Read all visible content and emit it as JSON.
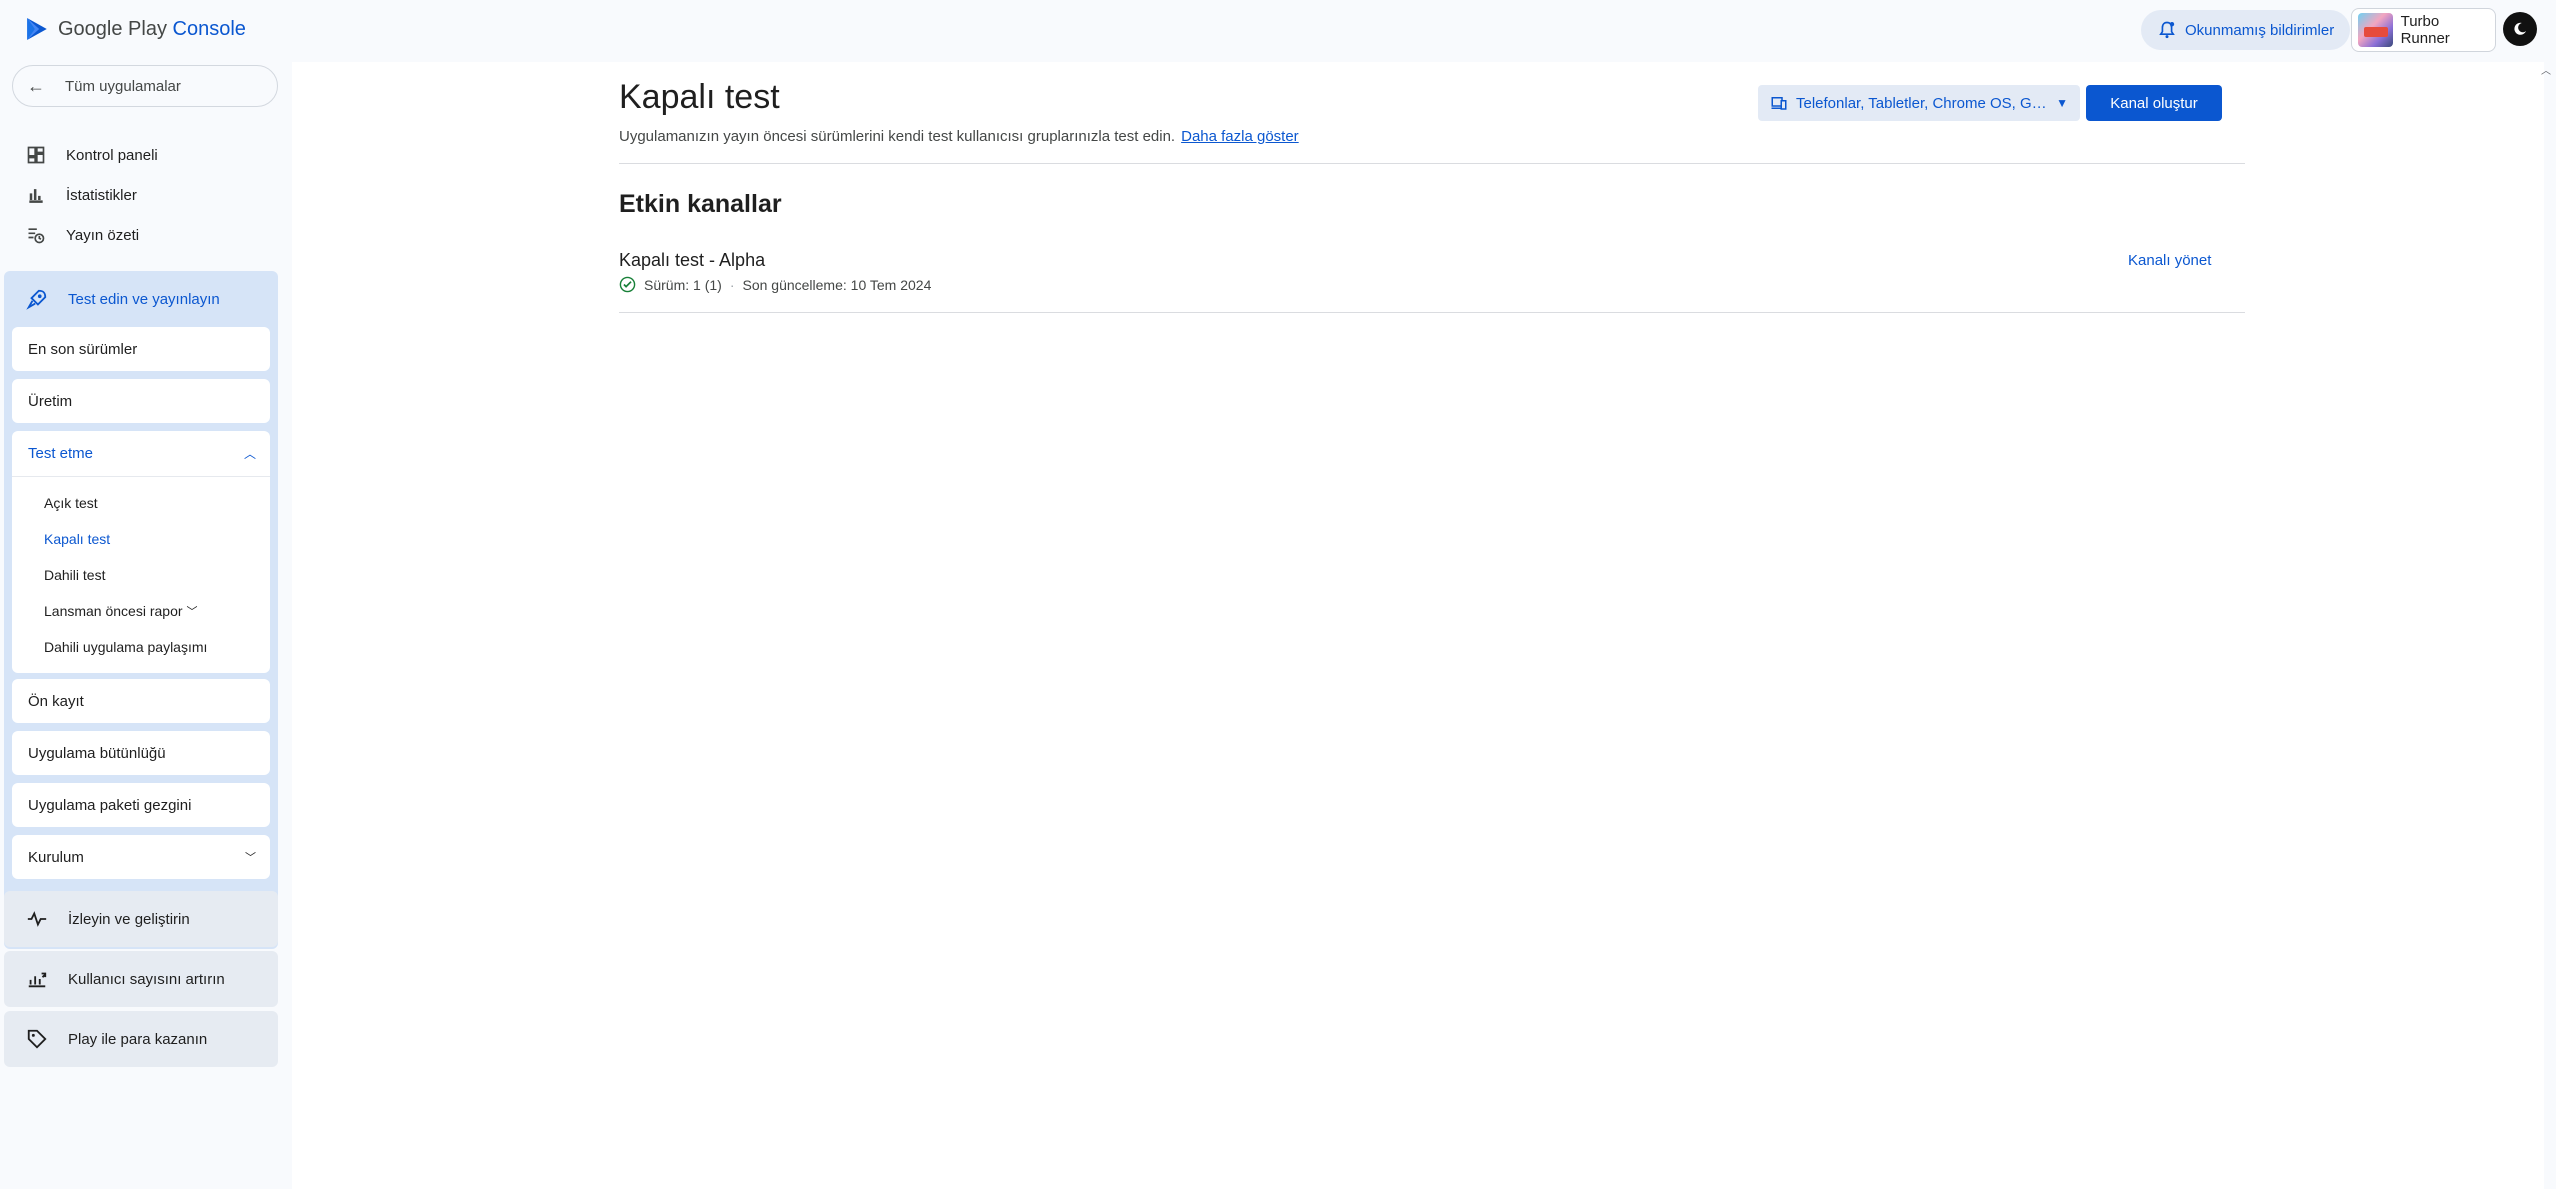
{
  "header": {
    "logo_text_a": "Google Play",
    "logo_text_b": "Console",
    "notifications_label": "Okunmamış bildirimler",
    "app_name": "Turbo Runner"
  },
  "sidebar": {
    "back_label": "Tüm uygulamalar",
    "top_items": [
      {
        "label": "Kontrol paneli",
        "icon": "dashboard-icon"
      },
      {
        "label": "İstatistikler",
        "icon": "bar-chart-icon"
      },
      {
        "label": "Yayın özeti",
        "icon": "publishing-overview-icon"
      }
    ],
    "release_group": {
      "label": "Test edin ve yayınlayın",
      "items": [
        "En son sürümler",
        "Üretim"
      ],
      "testing": {
        "label": "Test etme",
        "children": [
          "Açık test",
          "Kapalı test",
          "Dahili test",
          "Lansman öncesi rapor",
          "Dahili uygulama paylaşımı"
        ]
      },
      "items_after": [
        "Ön kayıt",
        "Uygulama bütünlüğü",
        "Uygulama paketi gezgini",
        "Kurulum"
      ]
    },
    "other_groups": [
      {
        "label": "İzleyin ve geliştirin",
        "icon": "monitor-icon"
      },
      {
        "label": "Kullanıcı sayısını artırın",
        "icon": "grow-icon"
      },
      {
        "label": "Play ile para kazanın",
        "icon": "monetize-tag-icon"
      }
    ]
  },
  "main": {
    "title": "Kapalı test",
    "description": "Uygulamanızın yayın öncesi sürümlerini kendi test kullanıcısı gruplarınızla test edin.",
    "learn_more": "Daha fazla göster",
    "device_filter": "Telefonlar, Tabletler, Chrome OS, Google TV",
    "create_track_label": "Kanal oluştur",
    "section_title": "Etkin kanallar",
    "tracks": [
      {
        "name": "Kapalı test - Alpha",
        "version": "Sürüm: 1 (1)",
        "last_update": "Son güncelleme: 10 Tem 2024",
        "manage_label": "Kanalı yönet"
      }
    ]
  },
  "colors": {
    "accent": "#0b57d0",
    "active_group_bg": "#d6e4f7",
    "success": "#188038"
  }
}
